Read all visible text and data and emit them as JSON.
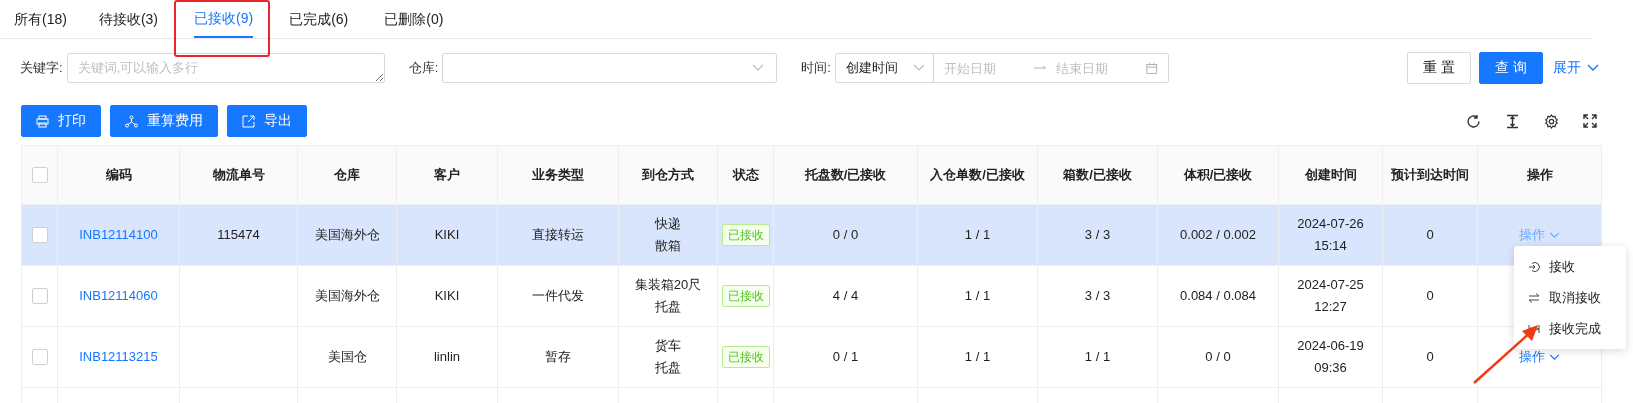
{
  "tabs": [
    {
      "label": "所有(18)",
      "selected": false
    },
    {
      "label": "待接收(3)",
      "selected": false
    },
    {
      "label": "已接收(9)",
      "selected": true,
      "highlighted": true
    },
    {
      "label": "已完成(6)",
      "selected": false
    },
    {
      "label": "已删除(0)",
      "selected": false
    }
  ],
  "filters": {
    "keyword": {
      "label": "关键字:",
      "placeholder": "关键词,可以输入多行"
    },
    "warehouse": {
      "label": "仓库:"
    },
    "time": {
      "label": "时间:",
      "type": "创建时间",
      "start_placeholder": "开始日期",
      "end_placeholder": "结束日期"
    },
    "reset": "重 置",
    "query": "查 询",
    "expand": "展开"
  },
  "actions": [
    {
      "kind": "print",
      "label": "打印"
    },
    {
      "kind": "recalc",
      "label": "重算费用"
    },
    {
      "kind": "export",
      "label": "导出"
    }
  ],
  "table": {
    "header_checked": false,
    "columns": [
      "编码",
      "物流单号",
      "仓库",
      "客户",
      "业务类型",
      "到仓方式",
      "状态",
      "托盘数/已接收",
      "入仓单数/已接收",
      "箱数/已接收",
      "体积/已接收",
      "创建时间",
      "预计到达时间",
      "操作"
    ],
    "rows": [
      {
        "selected": true,
        "checked": false,
        "code": "INB12114100",
        "tracking": "115474",
        "warehouse": "美国海外仓",
        "customer": "KIKI",
        "business": "直接转运",
        "arrival": [
          "快递",
          "散箱"
        ],
        "status": "已接收",
        "pallets": "0 / 0",
        "orders": "1 / 1",
        "boxes": "3 / 3",
        "volume": "0.002 / 0.002",
        "created": [
          "2024-07-26",
          "15:14"
        ],
        "eta": "0",
        "action": "操作",
        "action_hover": true
      },
      {
        "selected": false,
        "checked": false,
        "code": "INB12114060",
        "warehouse": "美国海外仓",
        "customer": "KIKI",
        "business": "一件代发",
        "arrival": [
          "集装箱20尺",
          "托盘"
        ],
        "status": "已接收",
        "pallets": "4 / 4",
        "orders": "1 / 1",
        "boxes": "3 / 3",
        "volume": "0.084 / 0.084",
        "created": [
          "2024-07-25",
          "12:27"
        ],
        "eta": "0"
      },
      {
        "selected": false,
        "checked": false,
        "code": "INB12113215",
        "warehouse": "美国仓",
        "customer": "linlin",
        "business": "暂存",
        "arrival": [
          "货车",
          "托盘"
        ],
        "status": "已接收",
        "pallets": "0 / 1",
        "orders": "1 / 1",
        "boxes": "1 / 1",
        "volume": "0 / 0",
        "created": [
          "2024-06-19",
          "09:36"
        ],
        "eta": "0",
        "action": "操作",
        "action_hover": false
      }
    ]
  },
  "menu": [
    {
      "kind": "receive",
      "label": "接收"
    },
    {
      "kind": "cancel",
      "label": "取消接收"
    },
    {
      "kind": "complete",
      "label": "接收完成"
    }
  ]
}
